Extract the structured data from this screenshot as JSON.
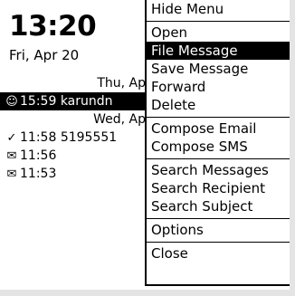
{
  "home": {
    "time": "13:20",
    "date": "Fri, Apr 20"
  },
  "messages": [
    {
      "kind": "header",
      "text": "Thu, Ap"
    },
    {
      "kind": "item",
      "icon": "☺",
      "icon_name": "clock-icon",
      "time": "15:59",
      "sender": "karundn",
      "selected": true
    },
    {
      "kind": "header",
      "text": "Wed, Ap"
    },
    {
      "kind": "item",
      "icon": "✓",
      "icon_name": "checkmark-icon",
      "time": "11:58",
      "sender": "5195551",
      "selected": false
    },
    {
      "kind": "item",
      "icon": "✉",
      "icon_name": "envelope-open-icon",
      "time": "11:56",
      "sender": "",
      "selected": false
    },
    {
      "kind": "item",
      "icon": "✉",
      "icon_name": "envelope-open-icon",
      "time": "11:53",
      "sender": "",
      "selected": false
    }
  ],
  "menu": {
    "hide": "Hide Menu",
    "open": "Open",
    "file_message": "File Message",
    "save_message": "Save Message",
    "forward": "Forward",
    "delete": "Delete",
    "compose_email": "Compose Email",
    "compose_sms": "Compose SMS",
    "search_messages": "Search Messages",
    "search_recipient": "Search Recipient",
    "search_subject": "Search Subject",
    "options": "Options",
    "close": "Close",
    "selected_item": "file_message"
  }
}
